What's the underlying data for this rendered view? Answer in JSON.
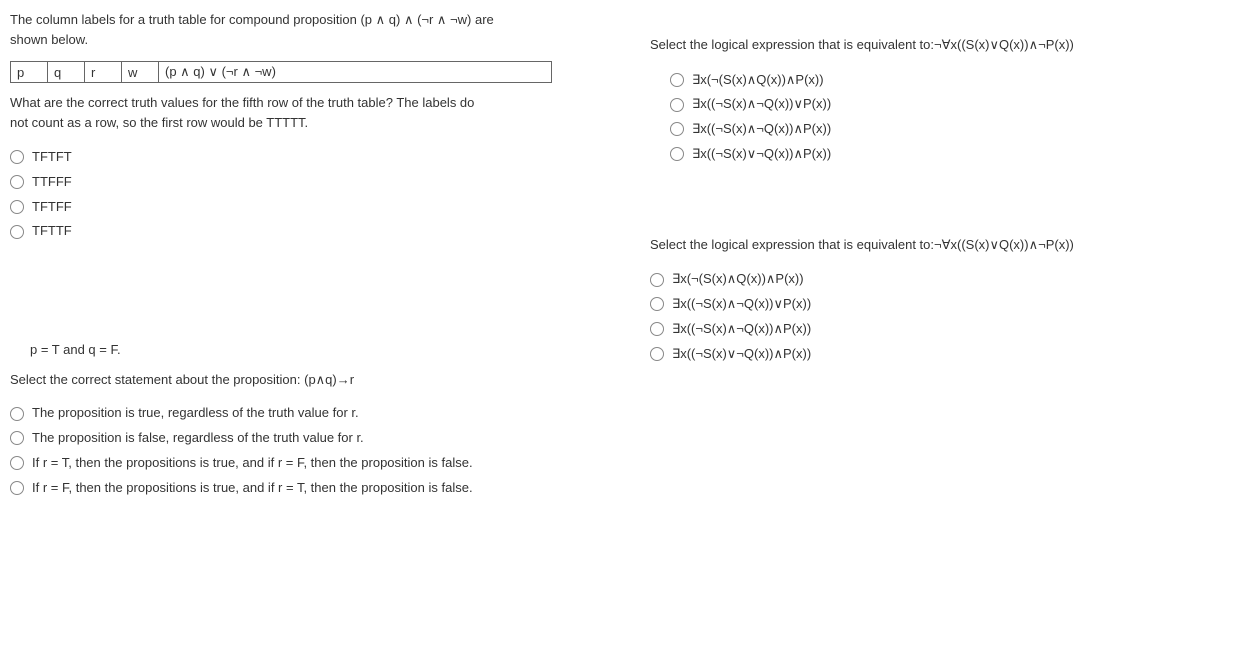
{
  "q1": {
    "intro1": "The column labels for a truth table for compound proposition (p ∧ q) ∧ (¬r ∧ ¬w) are",
    "intro2": "shown below.",
    "table_cols": [
      "p",
      "q",
      "r",
      "w",
      "(p ∧ q) ∨ (¬r ∧ ¬w)"
    ],
    "question1": "What are the correct truth values for the fifth row of the truth table? The labels do",
    "question2": "not count as a row, so the first row would be TTTTT.",
    "options": [
      "TFTFT",
      "TTFFF",
      "TFTFF",
      "TFTTF"
    ]
  },
  "q2": {
    "given": "p = T and q = F.",
    "prompt": "Select the correct statement about the proposition: (p∧q)→r",
    "options": [
      "The proposition is true, regardless of the truth value for r.",
      "The proposition is false, regardless of the truth value for r.",
      "If r = T, then the propositions is true, and if r = F, then the proposition is false.",
      "If r = F, then the propositions is true, and if r = T, then the proposition is false."
    ]
  },
  "q3": {
    "prompt": "Select the logical expression that is equivalent to:¬∀x((S(x)∨Q(x))∧¬P(x))",
    "options": [
      "∃x(¬(S(x)∧Q(x))∧P(x))",
      "∃x((¬S(x)∧¬Q(x))∨P(x))",
      "∃x((¬S(x)∧¬Q(x))∧P(x))",
      "∃x((¬S(x)∨¬Q(x))∧P(x))"
    ]
  },
  "q4": {
    "prompt": "Select the logical expression that is equivalent to:¬∀x((S(x)∨Q(x))∧¬P(x))",
    "options": [
      "∃x(¬(S(x)∧Q(x))∧P(x))",
      "∃x((¬S(x)∧¬Q(x))∨P(x))",
      "∃x((¬S(x)∧¬Q(x))∧P(x))",
      "∃x((¬S(x)∨¬Q(x))∧P(x))"
    ]
  }
}
